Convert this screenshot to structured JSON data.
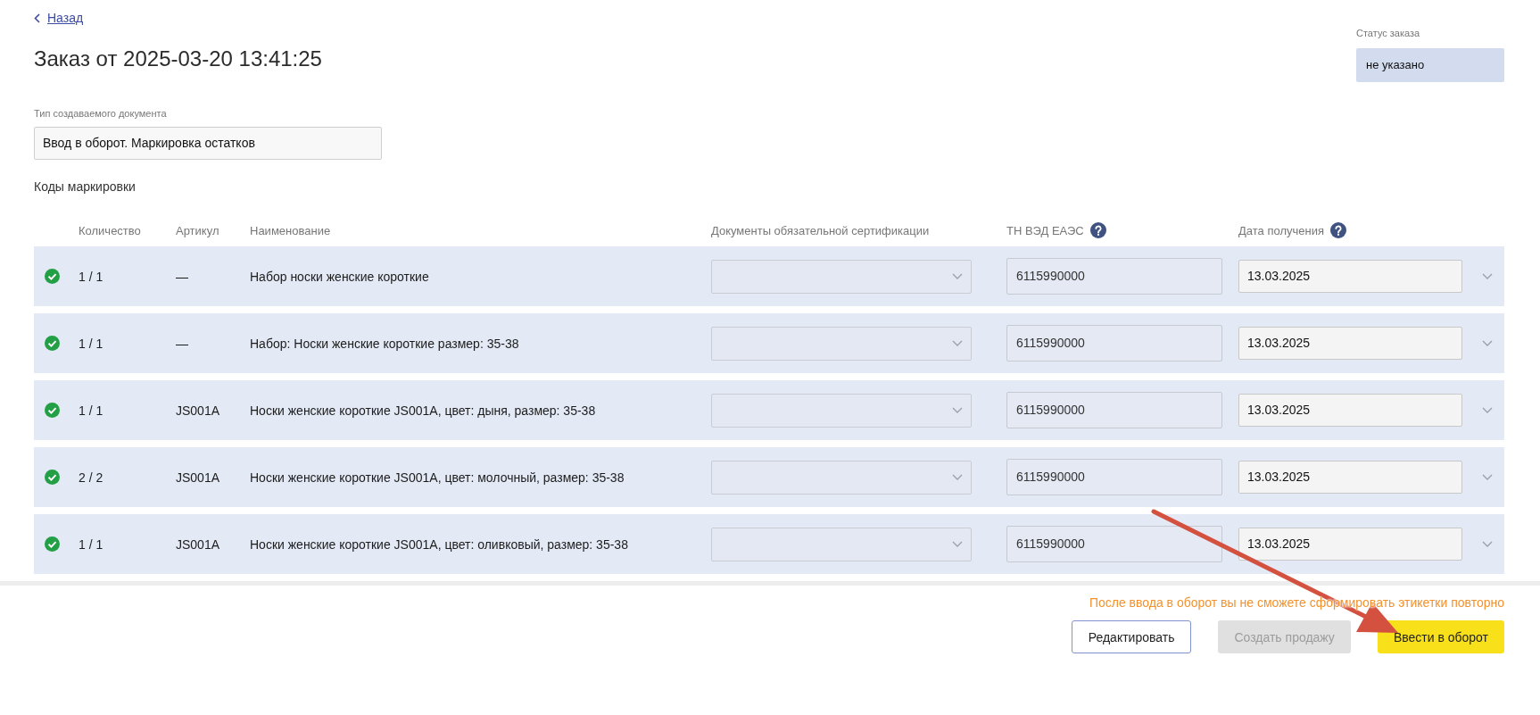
{
  "back_link": {
    "label": "Назад"
  },
  "title": "Заказ от 2025-03-20 13:41:25",
  "order_status": {
    "label": "Статус заказа",
    "value": "не указано"
  },
  "document_type": {
    "label": "Тип создаваемого документа",
    "value": "Ввод в оборот. Маркировка остатков"
  },
  "section_title": "Коды маркировки",
  "table": {
    "columns": [
      {
        "label": "Количество",
        "help": false
      },
      {
        "label": "Артикул",
        "help": false
      },
      {
        "label": "Наименование",
        "help": false
      },
      {
        "label": "Документы обязательной сертификации",
        "help": false
      },
      {
        "label": "ТН ВЭД ЕАЭС",
        "help": true
      },
      {
        "label": "Дата получения",
        "help": true
      }
    ],
    "rows": [
      {
        "valid": true,
        "quantity": "1 / 1",
        "article": "—",
        "name": "Набор носки женские короткие",
        "tnved": "6115990000",
        "received_date": "13.03.2025",
        "expanded": false
      },
      {
        "valid": true,
        "quantity": "1 / 1",
        "article": "—",
        "name": "Набор: Носки женские короткие размер: 35-38",
        "tnved": "6115990000",
        "received_date": "13.03.2025",
        "expanded": false
      },
      {
        "valid": true,
        "quantity": "1 / 1",
        "article": "JS001A",
        "name": "Носки женские короткие JS001A, цвет: дыня, размер: 35-38",
        "tnved": "6115990000",
        "received_date": "13.03.2025",
        "expanded": false
      },
      {
        "valid": true,
        "quantity": "2 / 2",
        "article": "JS001A",
        "name": "Носки женские короткие JS001A, цвет: молочный, размер: 35-38",
        "tnved": "6115990000",
        "received_date": "13.03.2025",
        "expanded": false
      },
      {
        "valid": true,
        "quantity": "1 / 1",
        "article": "JS001A",
        "name": "Носки женские короткие JS001A, цвет: оливковый, размер: 35-38",
        "tnved": "6115990000",
        "received_date": "13.03.2025",
        "expanded": false
      }
    ]
  },
  "warning": "После ввода в оборот вы не сможете сформировать этикетки повторно",
  "buttons": [
    {
      "label": "Редактировать",
      "kind": "outline",
      "disabled": false
    },
    {
      "label": "Создать продажу",
      "kind": "primary",
      "disabled": true
    },
    {
      "label": "Ввести в оборот",
      "kind": "primary",
      "disabled": false
    }
  ],
  "annotations": [
    {
      "kind": "arrow"
    }
  ]
}
